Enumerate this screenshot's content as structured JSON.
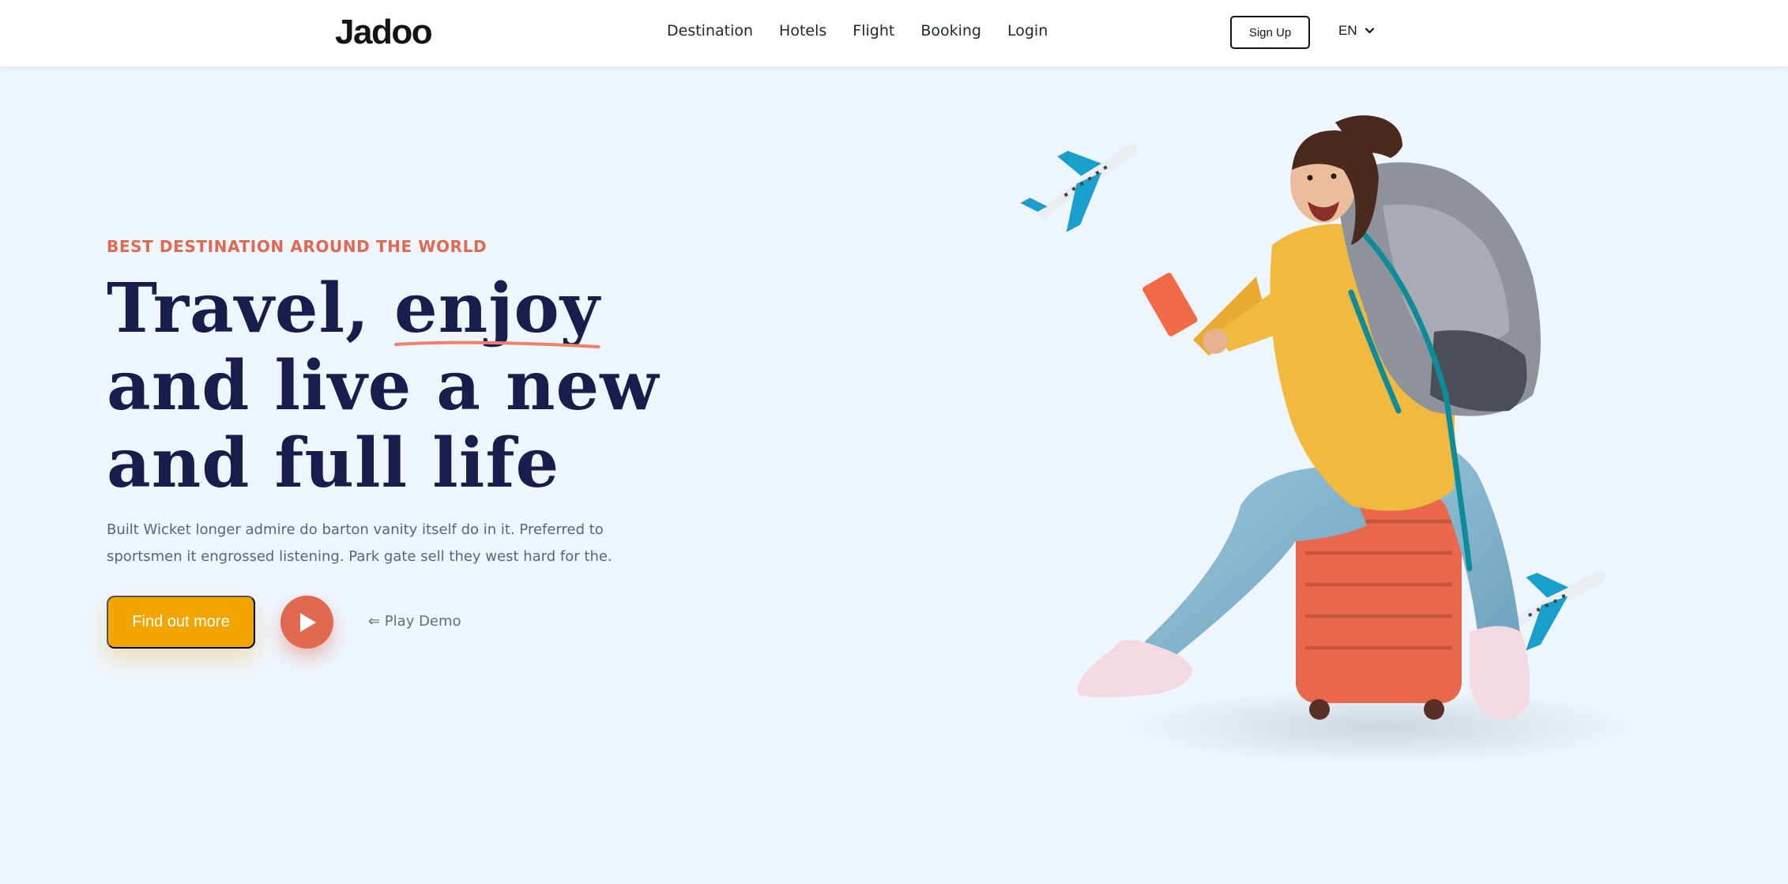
{
  "brand": {
    "logo_text": "Jadoo"
  },
  "nav": {
    "items": [
      "Destination",
      "Hotels",
      "Flight",
      "Booking",
      "Login"
    ]
  },
  "header": {
    "signup_label": "Sign Up",
    "language": "EN"
  },
  "hero": {
    "tagline": "BEST DESTINATION AROUND THE WORLD",
    "headline_line1_a": "Travel, ",
    "headline_line1_b": "enjoy",
    "headline_line2": "and live a new",
    "headline_line3": "and full life",
    "description": "Built Wicket longer admire do barton vanity itself do in it. Preferred to sportsmen it engrossed listening. Park gate sell they west hard for the.",
    "cta_label": "Find out more",
    "play_label": "⇐ Play Demo"
  },
  "colors": {
    "accent": "#df6951",
    "primary_dark": "#181e4b",
    "cta": "#f1a501",
    "background": "#eef5fc",
    "plane_blue": "#1a9ecb"
  },
  "icons": {
    "play": "play-icon",
    "chevron": "chevron-down-icon",
    "illustration": "traveler-with-backpack-and-suitcase",
    "planes": [
      "airplane-icon",
      "airplane-icon"
    ]
  }
}
